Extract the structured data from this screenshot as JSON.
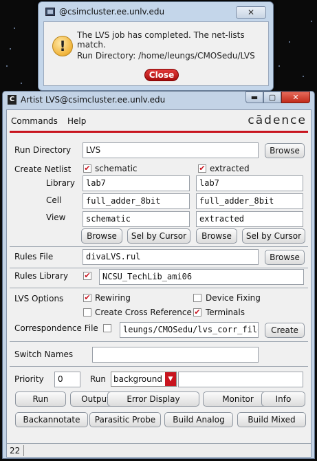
{
  "dialog": {
    "title": "@csimcluster.ee.unlv.edu",
    "message": "The LVS job has completed. The net-lists match.",
    "run_directory": "Run Directory: /home/leungs/CMOSedu/LVS",
    "close_label": "Close",
    "title_close_glyph": "✕",
    "icon": "warning-icon"
  },
  "window": {
    "title": "Artist LVS@csimcluster.ee.unlv.edu",
    "minimize_glyph": "▬",
    "maximize_glyph": "▢",
    "close_glyph": "✕",
    "app_icon_letter": "C"
  },
  "menu": {
    "commands": "Commands",
    "help": "Help",
    "brand": "cādence"
  },
  "form": {
    "run_directory_label": "Run Directory",
    "run_directory_value": "LVS",
    "browse_label": "Browse",
    "create_netlist_label": "Create Netlist",
    "schematic_check_label": "schematic",
    "extracted_check_label": "extracted",
    "library_label": "Library",
    "cell_label": "Cell",
    "view_label": "View",
    "sch_library": "lab7",
    "sch_cell": "full_adder_8bit",
    "sch_view": "schematic",
    "ext_library": "lab7",
    "ext_cell": "full_adder_8bit",
    "ext_view": "extracted",
    "sel_by_cursor_label": "Sel by Cursor",
    "rules_file_label": "Rules File",
    "rules_file_value": "divaLVS.rul",
    "rules_library_label": "Rules Library",
    "rules_library_value": "NCSU_TechLib_ami06",
    "lvs_options_label": "LVS Options",
    "rewiring_label": "Rewiring",
    "device_fixing_label": "Device Fixing",
    "create_cross_reference_label": "Create Cross Reference",
    "terminals_label": "Terminals",
    "correspondence_file_label": "Correspondence File",
    "correspondence_file_value": "leungs/CMOSedu/lvs_corr_file",
    "create_label": "Create",
    "switch_names_label": "Switch Names",
    "switch_names_value": "",
    "priority_label": "Priority",
    "priority_value": "0",
    "run_label": "Run",
    "run_mode_value": "background",
    "run_extra_value": ""
  },
  "buttons_row1": [
    "Run",
    "Output",
    "Error Display",
    "Monitor",
    "Info"
  ],
  "buttons_row2": [
    "Backannotate",
    "Parasitic Probe",
    "Build Analog",
    "Build Mixed"
  ],
  "status": {
    "number": "22"
  },
  "checks": {
    "schematic": true,
    "extracted": true,
    "rules_library": true,
    "rewiring": true,
    "device_fixing": false,
    "create_cross_reference": false,
    "terminals": true,
    "correspondence_file": false
  },
  "colors": {
    "accent_red": "#c8141e",
    "window_frame": "#c3d3e6"
  }
}
